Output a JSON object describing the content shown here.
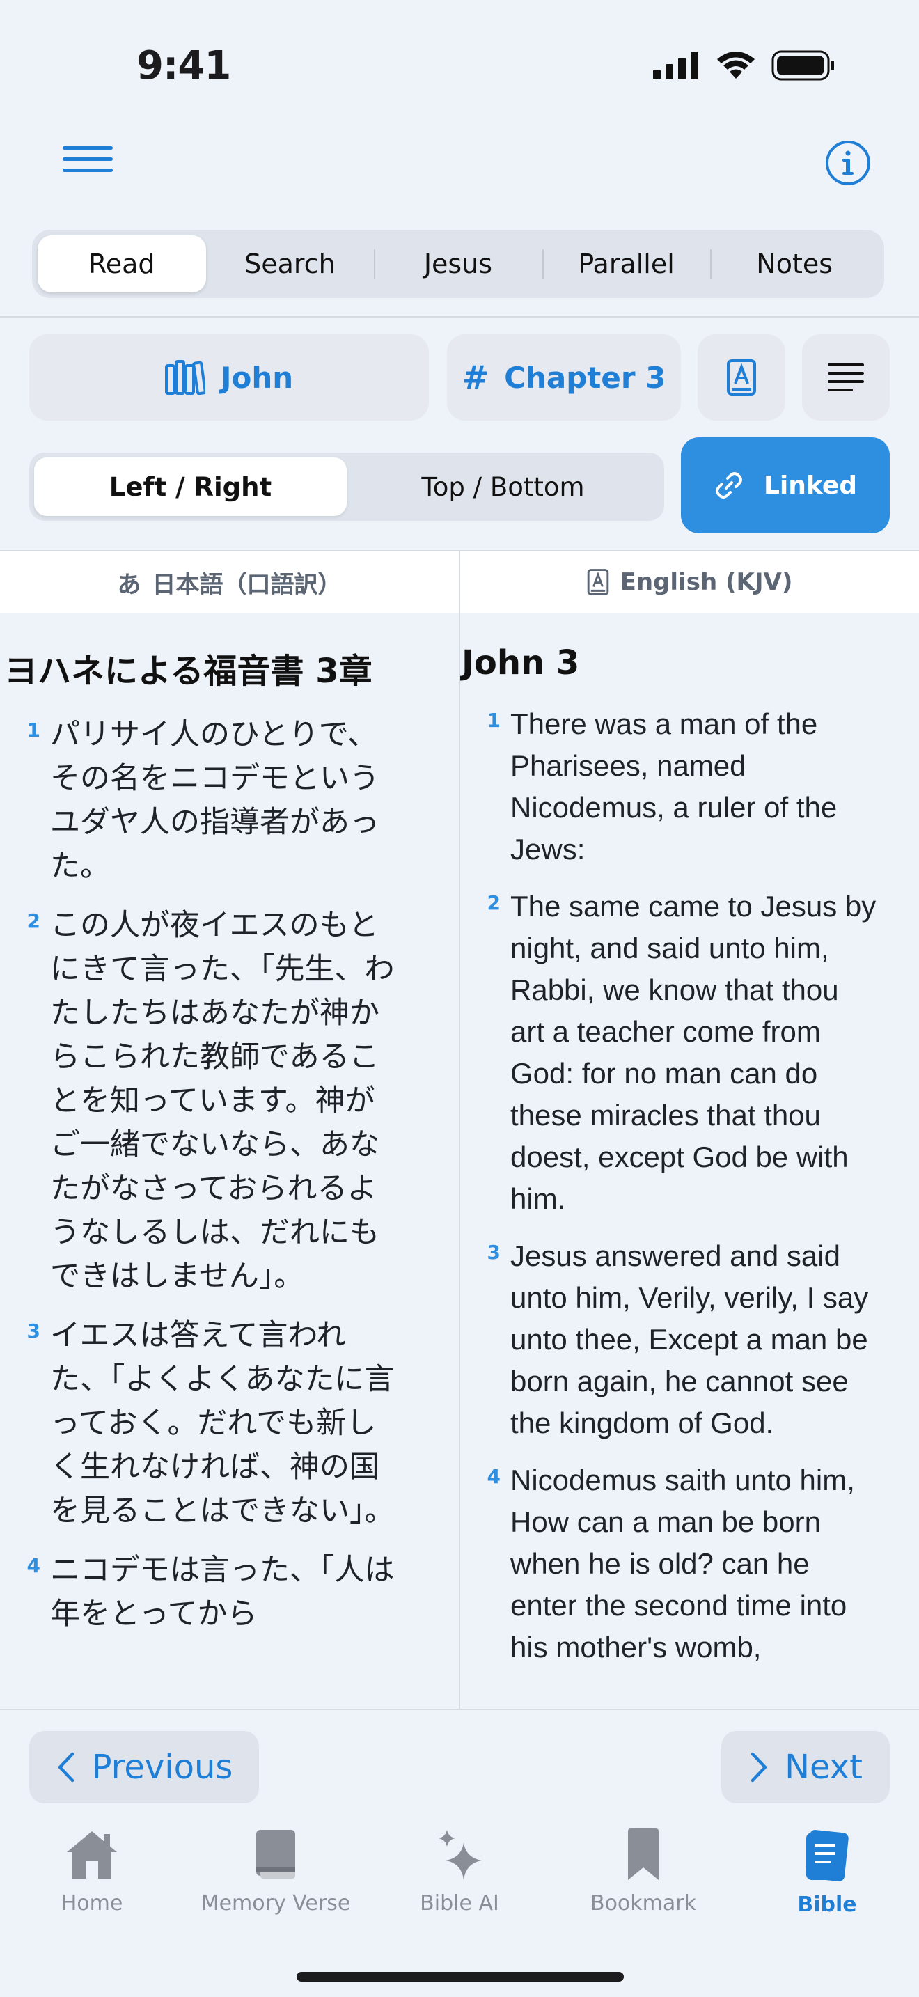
{
  "status_bar": {
    "time": "9:41"
  },
  "tabs": [
    {
      "label": "Read",
      "active": true
    },
    {
      "label": "Search",
      "active": false
    },
    {
      "label": "Jesus",
      "active": false
    },
    {
      "label": "Parallel",
      "active": false
    },
    {
      "label": "Notes",
      "active": false
    }
  ],
  "selector": {
    "book": "John",
    "chapter": "Chapter 3"
  },
  "layout_toggle": {
    "left_right": "Left / Right",
    "top_bottom": "Top / Bottom",
    "selected": "Left / Right"
  },
  "linked_label": "Linked",
  "columns": {
    "left": {
      "header_glyph": "あ",
      "header": "日本語（口語訳）",
      "title": "ヨハネによる福音書 3章",
      "verses": [
        {
          "num": "1",
          "text": "パリサイ人のひとりで、その名をニコデモというユダヤ人の指導者があった。"
        },
        {
          "num": "2",
          "text": "この人が夜イエスのもとにきて言った、「先生、わたしたちはあなたが神からこられた教師であることを知っています。神がご一緒でないなら、あなたがなさっておられるようなしるしは、だれにもできはしません」。"
        },
        {
          "num": "3",
          "text": "イエスは答えて言われた、「よくよくあなたに言っておく。だれでも新しく生れなければ、神の国を見ることはできない」。"
        },
        {
          "num": "4",
          "text": "ニコデモは言った、「人は年をとってから"
        }
      ]
    },
    "right": {
      "header": "English (KJV)",
      "title": "John 3",
      "verses": [
        {
          "num": "1",
          "text": "There was a man of the Pharisees, named Nicodemus, a ruler of the Jews:"
        },
        {
          "num": "2",
          "text": "The same came to Jesus by night, and said unto him, Rabbi, we know that thou art a teacher come from God: for no man can do these miracles that thou doest, except God be with him."
        },
        {
          "num": "3",
          "text": "Jesus answered and said unto him, Verily, verily, I say unto thee, Except a man be born again, he cannot see the kingdom of God."
        },
        {
          "num": "4",
          "text": "Nicodemus saith unto him, How can a man be born when he is old? can he enter the second time into his mother's womb,"
        }
      ]
    }
  },
  "navigation": {
    "previous": "Previous",
    "next": "Next"
  },
  "tabbar": [
    {
      "label": "Home",
      "icon": "home-icon",
      "active": false
    },
    {
      "label": "Memory Verse",
      "icon": "book-icon",
      "active": false
    },
    {
      "label": "Bible AI",
      "icon": "sparkle-icon",
      "active": false
    },
    {
      "label": "Bookmark",
      "icon": "bookmark-icon",
      "active": false
    },
    {
      "label": "Bible",
      "icon": "bible-icon",
      "active": true
    }
  ],
  "colors": {
    "accent": "#1f7fd6",
    "linked_bg": "#2e8ee0",
    "inactive": "#8a8f97",
    "background": "#eef3fa"
  }
}
